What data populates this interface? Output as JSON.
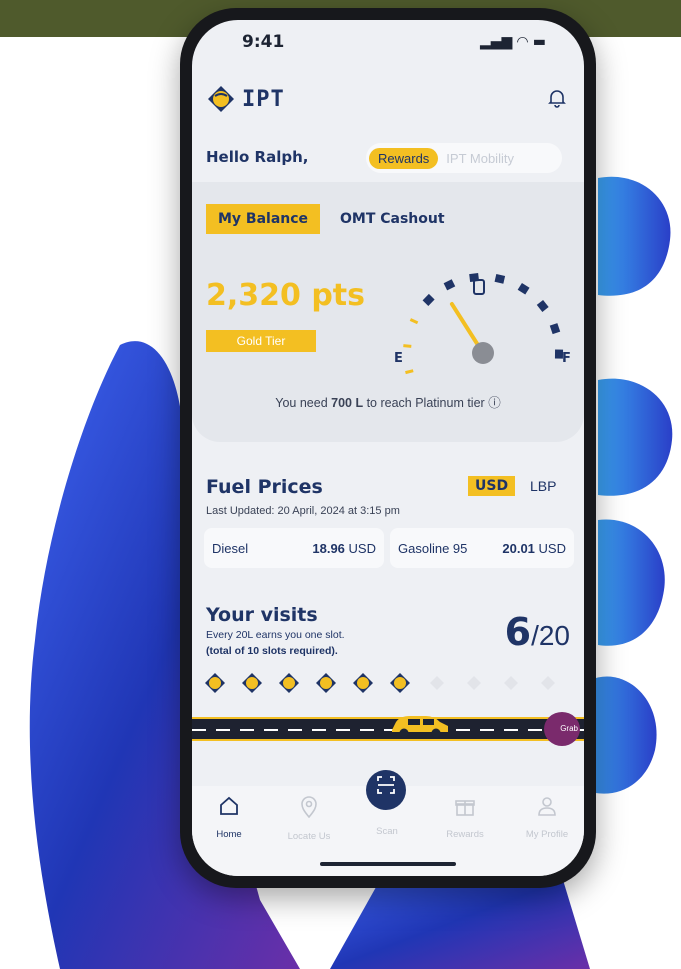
{
  "status": {
    "time": "9:41",
    "icons": "signal-wifi-battery"
  },
  "header": {
    "logo_text": "IPT",
    "bell_icon": "bell-icon"
  },
  "greeting": "Hello Ralph,",
  "mode_toggle": {
    "active": "Rewards",
    "inactive": "IPT Mobility"
  },
  "balance_tabs": {
    "active": "My Balance",
    "inactive": "OMT Cashout"
  },
  "balance": {
    "points": "2,320 pts",
    "tier": "Gold Tier",
    "gauge_empty": "E",
    "gauge_full": "F",
    "gauge_level": 0.4
  },
  "tier_note": {
    "prefix": "You need ",
    "amount": "700 L",
    "suffix": " to reach Platinum tier"
  },
  "fuel": {
    "title": "Fuel Prices",
    "currency_active": "USD",
    "currency_inactive": "LBP",
    "updated": "Last Updated: 20 April, 2024 at 3:15 pm",
    "prices": [
      {
        "name": "Diesel",
        "value": "18.96",
        "unit": "USD"
      },
      {
        "name": "Gasoline 95",
        "value": "20.01",
        "unit": "USD"
      }
    ]
  },
  "visits": {
    "title": "Your visits",
    "line1": "Every 20L earns you one slot.",
    "line2": "(total of 10 slots required).",
    "count": "6",
    "total": "/20",
    "filled_slots": 6,
    "total_slots": 10
  },
  "road": {
    "badge": "Grab"
  },
  "nav": [
    {
      "label": "Home",
      "icon": "home-icon"
    },
    {
      "label": "Locate Us",
      "icon": "location-pin-icon"
    },
    {
      "label": "Scan",
      "icon": "scan-icon"
    },
    {
      "label": "Rewards",
      "icon": "gift-icon"
    },
    {
      "label": "My Profile",
      "icon": "profile-icon"
    }
  ],
  "colors": {
    "brand_blue": "#1f3466",
    "accent_yellow": "#f3bf22",
    "background": "#eef0f4",
    "hand_blue": "#2b4fd6"
  }
}
